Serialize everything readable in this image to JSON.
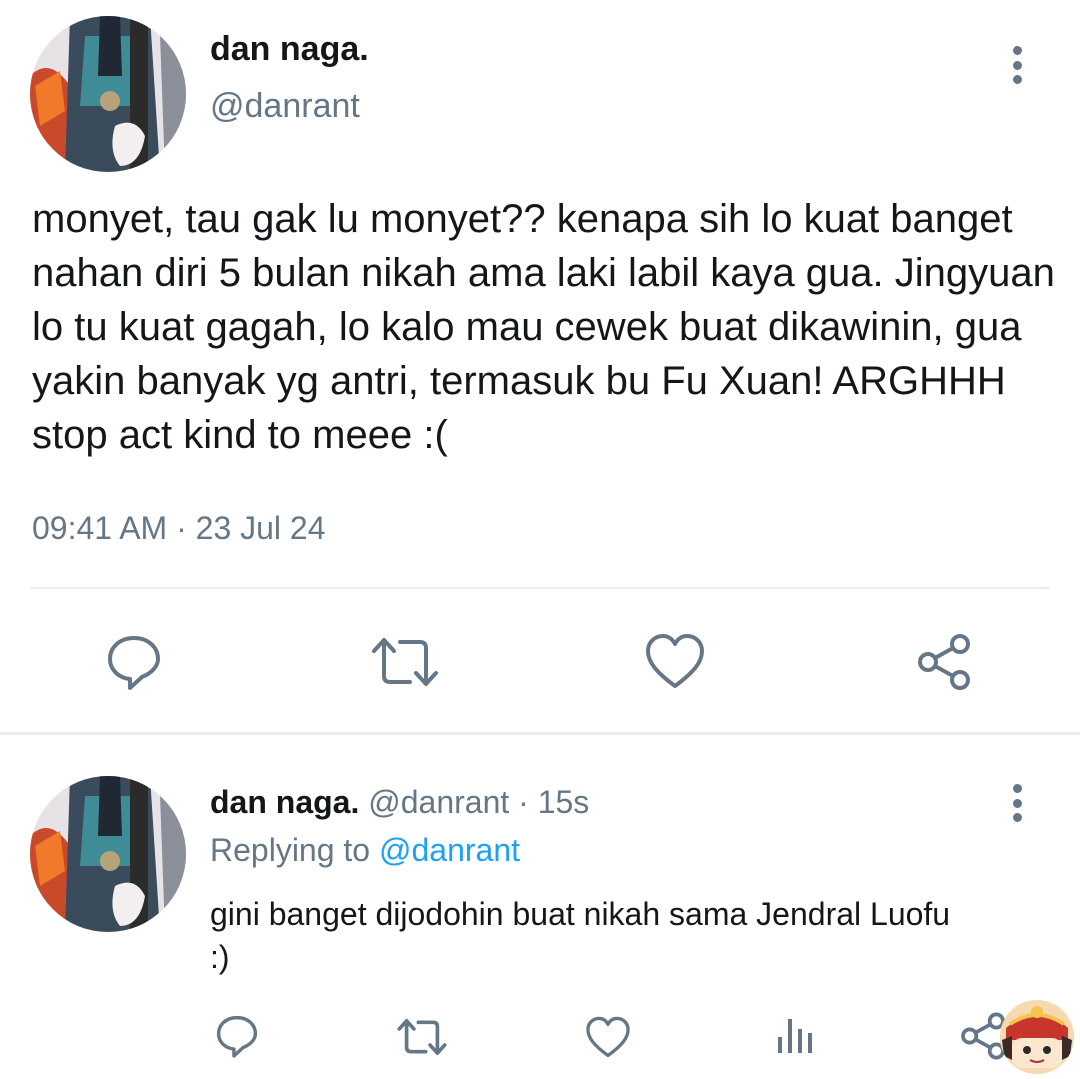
{
  "main_tweet": {
    "display_name": "dan naga.",
    "handle": "@danrant",
    "text": "monyet, tau gak lu monyet?? kenapa sih lo kuat banget nahan diri 5 bulan nikah ama laki labil kaya gua. Jingyuan lo tu kuat gagah, lo kalo mau cewek buat dikawinin, gua yakin banyak yg antri, termasuk bu Fu Xuan! ARGHHH stop act kind to meee :(",
    "time": "09:41 AM",
    "separator": "·",
    "date": "23 Jul 24",
    "actions": [
      "reply-icon",
      "retweet-icon",
      "like-icon",
      "share-icon"
    ]
  },
  "reply_tweet": {
    "display_name": "dan naga.",
    "handle": "@danrant",
    "separator": "·",
    "age": "15s",
    "replying_label": "Replying to",
    "replying_handle": "@danrant",
    "text": "gini banget dijodohin buat nikah sama Jendral Luofu :)",
    "actions": [
      "reply-icon",
      "retweet-icon",
      "like-icon",
      "analytics-icon",
      "share-icon"
    ]
  },
  "colors": {
    "text": "#14171a",
    "muted": "#657786",
    "link": "#1da1f2",
    "divider": "#e6ecf0"
  }
}
